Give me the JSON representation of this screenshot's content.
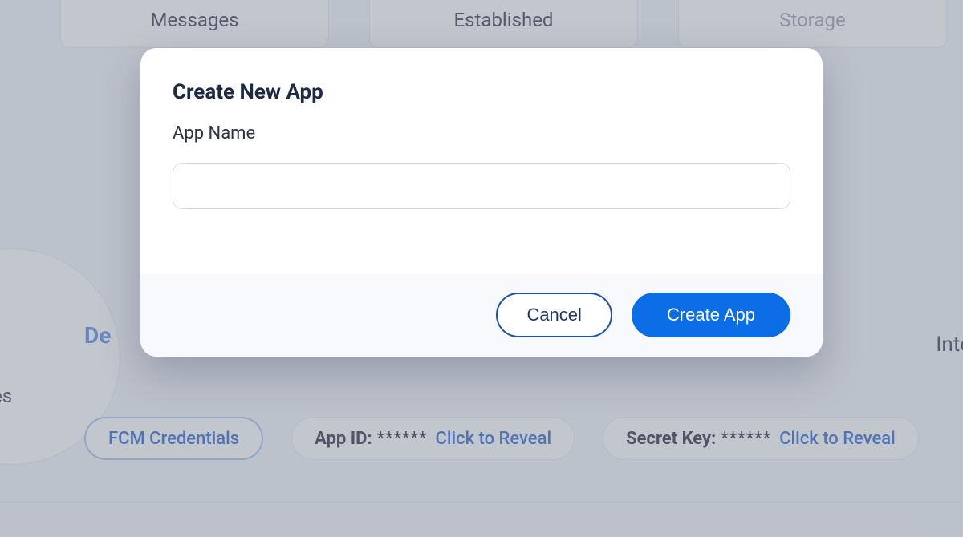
{
  "background": {
    "tabs": [
      {
        "label": "Messages"
      },
      {
        "label": "Established"
      },
      {
        "label": "Storage"
      }
    ],
    "details_label": "De",
    "es_fragment": "es",
    "inte_fragment": "Inte",
    "pills": {
      "fcm": {
        "label": "FCM Credentials"
      },
      "app_id": {
        "label": "App ID:",
        "masked": "******",
        "reveal": "Click to Reveal"
      },
      "secret_key": {
        "label": "Secret Key:",
        "masked": "******",
        "reveal": "Click to Reveal"
      }
    }
  },
  "modal": {
    "title": "Create New App",
    "field_label": "App Name",
    "input_value": "",
    "input_placeholder": "",
    "cancel_label": "Cancel",
    "create_label": "Create App"
  }
}
